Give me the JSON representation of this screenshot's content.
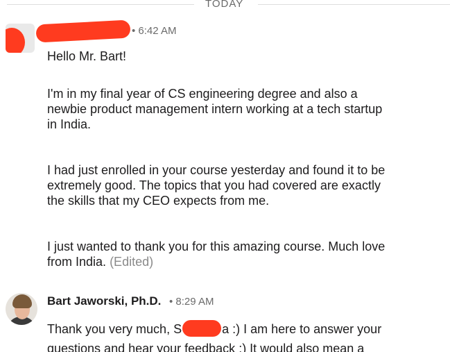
{
  "divider": {
    "label": "TODAY"
  },
  "message1": {
    "timestamp": "• 6:42 AM",
    "paragraphs": [
      "Hello Mr. Bart!",
      "I'm in my final year of CS engineering degree and also a newbie product management intern working at a tech startup in India.",
      "I had just enrolled in your course yesterday and found it to be extremely good. The topics that you had covered are exactly the skills that my CEO expects from me.",
      "I just wanted to thank you for this amazing course. Much love from India."
    ],
    "edited": "(Edited)"
  },
  "message2": {
    "sender": "Bart Jaworski, Ph.D.",
    "timestamp": "• 8:29 AM",
    "line1_before": "Thank you very much, S",
    "line1_after": "a :) I am here to answer your",
    "line2": "questions and hear your feedback :) It would also mean a"
  },
  "colors": {
    "redaction": "#ff3b1f",
    "timestamp": "#6b6b6b",
    "edited": "#8a8a8a"
  }
}
